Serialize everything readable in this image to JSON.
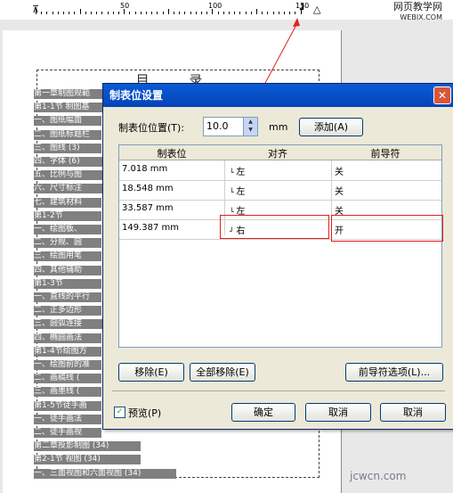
{
  "ruler": {
    "labels": [
      "50",
      "100",
      "150"
    ]
  },
  "watermark_top": {
    "title": "网页教学网",
    "site": "WEBJX.COM"
  },
  "document": {
    "title": "目  录",
    "toc": [
      "第一章制图规範",
      "第1-1节 制图基",
      "一、图纸幅面",
      "二、图纸标题栏",
      "三、图线 (3)",
      "四、字体 (6)",
      "五、比例与图",
      "六、尺寸标注",
      "七、建筑材料",
      "第1-2节",
      "一、绘图板、",
      "二、分规、圆",
      "三、绘图用笔",
      "四、其他辅助",
      "第1-3节",
      "一、直线的平行",
      "二、正多边形",
      "三、圆弧连接",
      "四、椭圆画法",
      "第1-4节绘图方",
      "一、绘图前的准",
      "二、画稿线 (",
      "三、画墨线 (",
      "第1-5节徒手画",
      "一、徒手画法",
      "二、徒手画视",
      "第二章投影制图 (34)",
      "第2-1节      视图 (34)",
      "一、三面视图和六面视图 (34)"
    ]
  },
  "dialog": {
    "title": "制表位设置",
    "close_icon": "close-icon",
    "position_label": "制表位位置(T):",
    "position_value": "10.0",
    "unit": "mm",
    "add_button": "添加(A)",
    "columns": [
      "制表位",
      "对齐",
      "前导符"
    ],
    "rows": [
      {
        "pos": "7.018 mm",
        "align": "左",
        "leader": "关"
      },
      {
        "pos": "18.548 mm",
        "align": "左",
        "leader": "关"
      },
      {
        "pos": "33.587 mm",
        "align": "左",
        "leader": "关"
      },
      {
        "pos": "149.387 mm",
        "align": "右",
        "leader": "开"
      }
    ],
    "remove_button": "移除(E)",
    "remove_all_button": "全部移除(E)",
    "leader_options_button": "前导符选项(L)...",
    "preview_label": "预览(P)",
    "preview_checked": true,
    "ok_button": "确定",
    "cancel_button": "取消",
    "cancel_button2": "取消"
  },
  "watermark_bottom": "jcwcn.com"
}
